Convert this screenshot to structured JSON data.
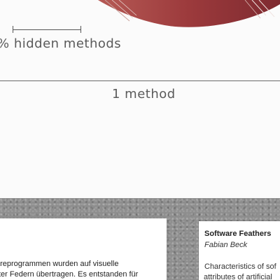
{
  "poster": {
    "hidden_methods_label": "% hidden methods",
    "method_label": "1 method",
    "feather_color": "#9c3a3c"
  },
  "cards": {
    "left": {
      "line1": "areprogrammen wurden auf visuelle",
      "line2": "ter Federn übertragen. Es entstanden für"
    },
    "right": {
      "title": "Software Feathers",
      "author": "Fabian Beck",
      "line1": "Characteristics of sof",
      "line2": "attributes of artificial"
    }
  }
}
